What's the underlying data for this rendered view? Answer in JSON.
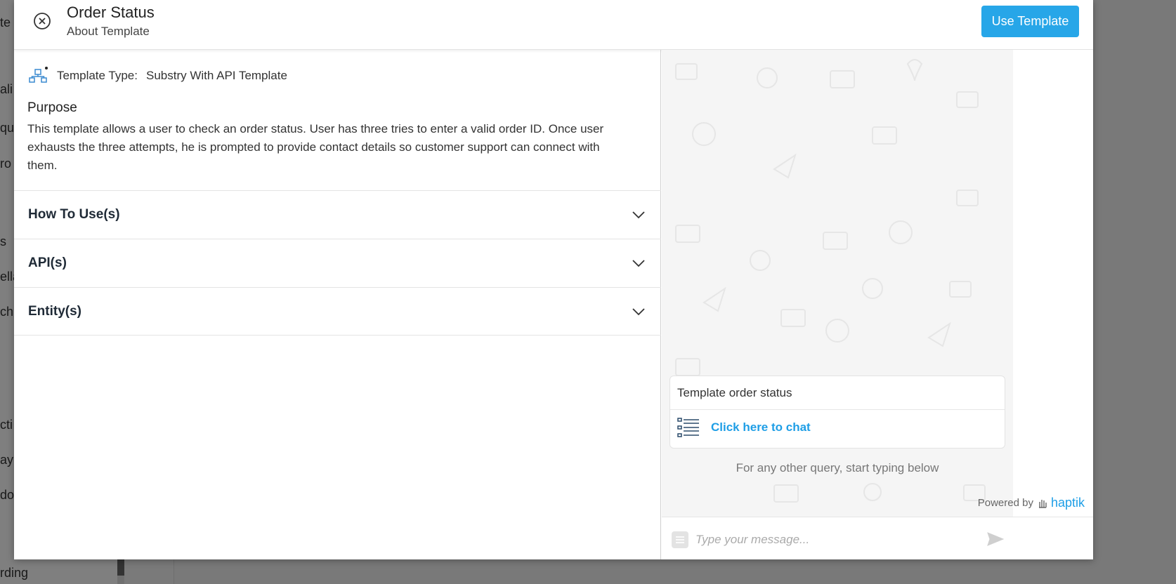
{
  "background": {
    "fragments": [
      "te",
      "ali",
      "qu",
      "ro",
      "s",
      "ella",
      "ch",
      "cti",
      "ay",
      "do",
      "rding"
    ]
  },
  "modal": {
    "title": "Order Status",
    "subtitle": "About Template",
    "use_template_label": "Use Template",
    "close_icon": "close-circle-icon"
  },
  "details": {
    "template_type_label": "Template Type:",
    "template_type_value": "Substry With API Template",
    "purpose_title": "Purpose",
    "purpose_text": "This template allows a user to check an order status. User has three tries to enter a valid order ID. Once user exhausts the three attempts, he is prompted to provide contact details so customer support can connect with them."
  },
  "accordions": [
    {
      "label": "How To Use(s)"
    },
    {
      "label": "API(s)"
    },
    {
      "label": "Entity(s)"
    }
  ],
  "chat": {
    "card_title": "Template order status",
    "card_link": "Click here to chat",
    "query_hint": "For any other query, start typing below",
    "powered_by": "Powered by",
    "brand": "haptik",
    "input_placeholder": "Type your message..."
  },
  "colors": {
    "accent": "#27a6e8",
    "link": "#1e9ee6"
  }
}
